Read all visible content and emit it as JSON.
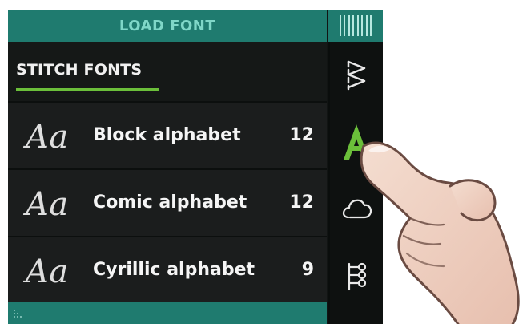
{
  "header": {
    "title": "LOAD FONT"
  },
  "section": {
    "title": "STITCH FONTS"
  },
  "fonts": [
    {
      "sample": "Aa",
      "name": "Block alphabet",
      "count": "12"
    },
    {
      "sample": "Aa",
      "name": "Comic alphabet",
      "count": "12"
    },
    {
      "sample": "Aa",
      "name": "Cyrillic alphabet",
      "count": "9"
    }
  ],
  "sidebar": {
    "buttons": [
      {
        "icon": "zigzag-stitch-icon"
      },
      {
        "icon": "alphabet-a-icon",
        "active": true,
        "active_color": "#6bbf3a"
      },
      {
        "icon": "cloud-icon"
      },
      {
        "icon": "stitch-sequence-icon"
      }
    ]
  },
  "colors": {
    "header": "#1f7b6f",
    "header_text": "#7fd7c8",
    "accent_green": "#6bbf3a",
    "background": "#111413",
    "row": "#1b1d1d",
    "text": "#f5f5f5"
  }
}
